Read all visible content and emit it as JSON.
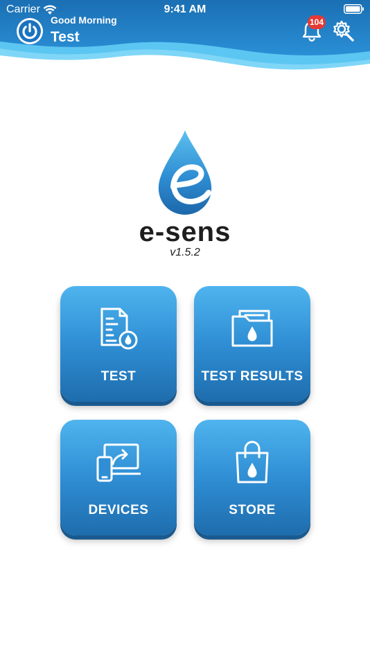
{
  "status_bar": {
    "carrier": "Carrier",
    "time": "9:41 AM",
    "icons": [
      "wifi-icon",
      "battery-icon"
    ]
  },
  "header": {
    "greeting": "Good Morning",
    "username": "Test",
    "notification_count": "104",
    "icons": [
      "power-icon",
      "bell-icon",
      "settings-icon"
    ],
    "colors": {
      "wave_dark": "#1b6fb3",
      "wave_light": "#5cc6f2",
      "badge": "#e53935"
    }
  },
  "brand": {
    "name": "e-sens",
    "version": "v1.5.2"
  },
  "tiles": [
    {
      "label": "TEST",
      "icon": "document-drop-icon"
    },
    {
      "label": "TEST RESULTS",
      "icon": "folder-drop-icon"
    },
    {
      "label": "DEVICES",
      "icon": "devices-share-icon"
    },
    {
      "label": "STORE",
      "icon": "shopping-bag-drop-icon"
    }
  ],
  "colors": {
    "tile_top": "#4fb4ee",
    "tile_bottom": "#1e6dad",
    "text_dark": "#1e1e1e"
  }
}
